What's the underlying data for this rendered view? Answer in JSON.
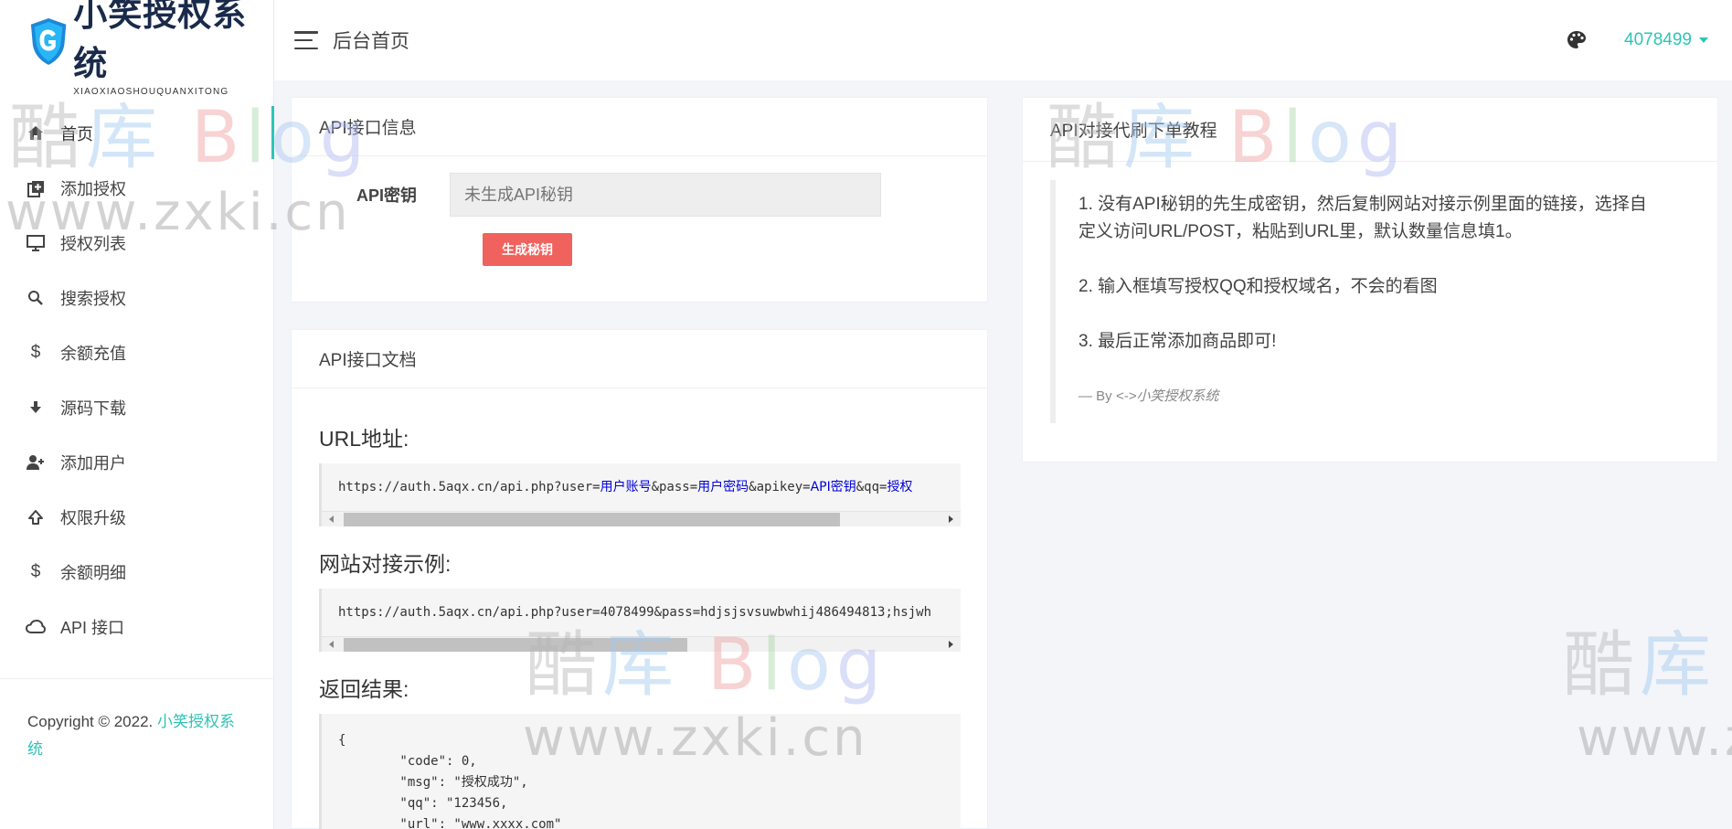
{
  "sidebar": {
    "logo_title": "小笑授权系统",
    "logo_sub": "XIAOXIAOSHOUQUANXITONG",
    "items": [
      {
        "label": "首页",
        "icon": "home-icon"
      },
      {
        "label": "添加授权",
        "icon": "add-box-icon"
      },
      {
        "label": "授权列表",
        "icon": "monitor-icon"
      },
      {
        "label": "搜索授权",
        "icon": "search-icon"
      },
      {
        "label": "余额充值",
        "icon": "dollar-icon"
      },
      {
        "label": "源码下载",
        "icon": "download-icon"
      },
      {
        "label": "添加用户",
        "icon": "add-user-icon"
      },
      {
        "label": "权限升级",
        "icon": "upgrade-icon"
      },
      {
        "label": "余额明细",
        "icon": "dollar-icon"
      },
      {
        "label": "API 接口",
        "icon": "cloud-icon"
      }
    ],
    "footer_text": "Copyright © 2022. ",
    "footer_link": "小笑授权系统"
  },
  "header": {
    "page_title": "后台首页",
    "username": "4078499"
  },
  "api_info": {
    "title": "API接口信息",
    "key_label": "API密钥",
    "key_placeholder": "未生成API秘钥",
    "generate_button": "生成秘钥"
  },
  "api_docs": {
    "title": "API接口文档",
    "url_title": "URL地址:",
    "url_prefix": "https://auth.5aqx.cn/api.php?user=",
    "url_user": "用户账号",
    "url_pass_key": "&pass=",
    "url_pass": "用户密码",
    "url_apikey_key": "&apikey=",
    "url_apikey": "API密钥",
    "url_qq_key": "&qq=",
    "url_qq": "授权",
    "example_title": "网站对接示例:",
    "example_url": "https://auth.5aqx.cn/api.php?user=4078499&pass=hdjsjsvsuwbwhij486494813;hsjwh",
    "result_title": "返回结果:",
    "result_lines": [
      "{",
      "        \"code\": 0,",
      "        \"msg\": \"授权成功\",",
      "        \"qq\": \"123456,",
      "        \"url\": \"www.xxxx.com\"",
      "}"
    ]
  },
  "tutorial": {
    "title": "API对接代刷下单教程",
    "step1": "1. 没有API秘钥的先生成密钥，然后复制网站对接示例里面的链接，选择自定义访问URL/POST，粘贴到URL里，默认数量信息填1。",
    "step2": "2. 输入框填写授权QQ和授权域名，不会的看图",
    "step3": "3. 最后正常添加商品即可!",
    "by_prefix": "— By ",
    "by_name": "<->小笑授权系统"
  },
  "watermark": {
    "ku1": "酷",
    "ku2": "库",
    "blog_b": "B",
    "blog_l": "l",
    "blog_o": "o",
    "blog_g": "g",
    "url": "www.zxki.cn"
  },
  "colors": {
    "accent": "#2ec4b6",
    "danger_button": "#f0625d",
    "link_blue": "#0000dd"
  }
}
